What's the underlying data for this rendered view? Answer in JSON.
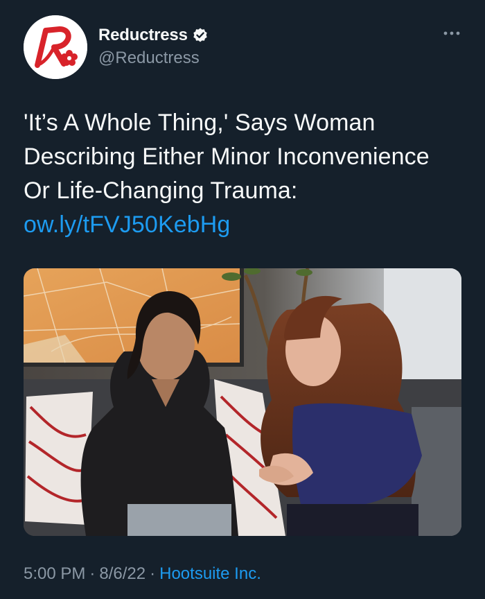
{
  "author": {
    "display_name": "Reductress",
    "handle": "@Reductress",
    "verified_icon": "verified-badge-icon",
    "avatar_icon": "reductress-logo-icon"
  },
  "tweet": {
    "text_parts": [
      "'It’s A Whole Thing,' Says Woman Describing Either Minor Inconvenience Or Life-Changing Trauma: "
    ],
    "link": "ow.ly/tFVJ50KebHg"
  },
  "meta": {
    "time": "5:00 PM",
    "separator": "·",
    "date": "8/6/22",
    "source": "Hootsuite Inc."
  },
  "colors": {
    "background": "#15202b",
    "text": "#f7f9f9",
    "secondary": "#8b98a5",
    "link": "#1d9bf0",
    "brand_red": "#d8232a"
  },
  "icons": {
    "more": "more-options-icon"
  }
}
